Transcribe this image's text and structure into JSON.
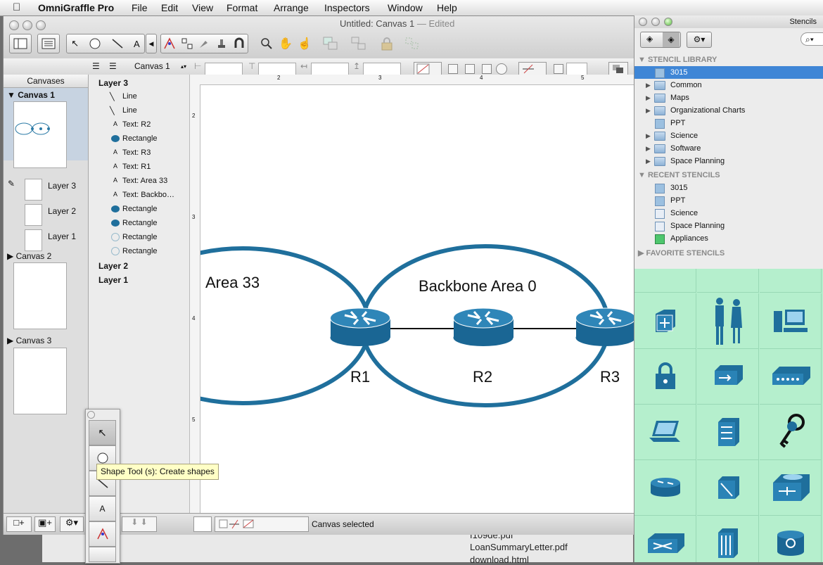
{
  "menubar": {
    "apple": "",
    "app_name": "OmniGraffle Pro",
    "items": [
      "File",
      "Edit",
      "View",
      "Format",
      "Arrange",
      "Inspectors",
      "Window",
      "Help"
    ]
  },
  "window": {
    "title": "Untitled: Canvas 1",
    "title_suffix": "— Edited",
    "canvas_selector": "Canvas 1"
  },
  "canvases_panel": {
    "header": "Canvases",
    "canvases": [
      {
        "label": "Canvas 1",
        "layers": [
          "Layer 3",
          "Layer 2",
          "Layer 1"
        ]
      },
      {
        "label": "Canvas 2"
      },
      {
        "label": "Canvas 3"
      }
    ]
  },
  "outline": {
    "layer3": "Layer 3",
    "items": [
      "Line",
      "Line",
      "Text: R2",
      "Rectangle",
      "Text: R3",
      "Text: R1",
      "Text: Area 33",
      "Text: Backbo…",
      "Rectangle",
      "Rectangle",
      "Rectangle",
      "Rectangle"
    ],
    "layer2": "Layer 2",
    "layer1": "Layer 1"
  },
  "diagram": {
    "area33": "Area 33",
    "backbone": "Backbone Area 0",
    "routers": [
      "R1",
      "R2",
      "R3"
    ]
  },
  "ruler": {
    "top_ticks": [
      "2",
      "3",
      "4",
      "5"
    ],
    "left_ticks": [
      "2",
      "3",
      "4",
      "5"
    ]
  },
  "status": {
    "text": "Canvas selected"
  },
  "tooltip": "Shape Tool (s): Create shapes",
  "stencils": {
    "title": "Stencils",
    "library_header": "STENCIL LIBRARY",
    "library": [
      "3015",
      "Common",
      "Maps",
      "Organizational Charts",
      "PPT",
      "Science",
      "Software",
      "Space Planning"
    ],
    "recent_header": "RECENT STENCILS",
    "recent": [
      "3015",
      "PPT",
      "Science",
      "Space Planning",
      "Appliances"
    ],
    "favorite_header": "FAVORITE STENCILS"
  },
  "desktop_files": [
    "f109de.pdf",
    "LoanSummaryLetter.pdf",
    "download.html"
  ],
  "colors": {
    "router_blue": "#1f6f9c",
    "stencil_bg": "#b5efcd",
    "selection": "#3f86d6"
  }
}
